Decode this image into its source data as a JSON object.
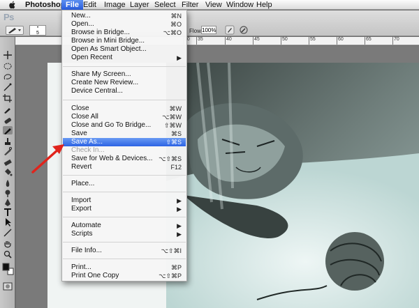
{
  "menubar": {
    "app": "Photoshop",
    "items": [
      "File",
      "Edit",
      "Image",
      "Layer",
      "Select",
      "Filter",
      "View",
      "Window",
      "Help"
    ]
  },
  "optionsbar": {
    "logo": "Ps",
    "brush_size": "5",
    "flow_label": "Flow:",
    "flow_value": "100%"
  },
  "ruler": {
    "labels": [
      "30",
      "35",
      "40",
      "45",
      "50",
      "55",
      "60",
      "65",
      "70"
    ]
  },
  "file_menu": {
    "groups": [
      [
        {
          "label": "New...",
          "shortcut": "⌘N"
        },
        {
          "label": "Open...",
          "shortcut": "⌘O"
        },
        {
          "label": "Browse in Bridge...",
          "shortcut": "⌥⌘O"
        },
        {
          "label": "Browse in Mini Bridge...",
          "shortcut": ""
        },
        {
          "label": "Open As Smart Object...",
          "shortcut": ""
        },
        {
          "label": "Open Recent",
          "shortcut": "▶"
        }
      ],
      [
        {
          "label": "Share My Screen...",
          "shortcut": ""
        },
        {
          "label": "Create New Review...",
          "shortcut": ""
        },
        {
          "label": "Device Central...",
          "shortcut": ""
        }
      ],
      [
        {
          "label": "Close",
          "shortcut": "⌘W"
        },
        {
          "label": "Close All",
          "shortcut": "⌥⌘W"
        },
        {
          "label": "Close and Go To Bridge...",
          "shortcut": "⇧⌘W"
        },
        {
          "label": "Save",
          "shortcut": "⌘S"
        },
        {
          "label": "Save As...",
          "shortcut": "⇧⌘S",
          "highlighted": true
        },
        {
          "label": "Check In...",
          "shortcut": "",
          "disabled": true
        },
        {
          "label": "Save for Web & Devices...",
          "shortcut": "⌥⇧⌘S"
        },
        {
          "label": "Revert",
          "shortcut": "F12"
        }
      ],
      [
        {
          "label": "Place...",
          "shortcut": ""
        }
      ],
      [
        {
          "label": "Import",
          "shortcut": "▶"
        },
        {
          "label": "Export",
          "shortcut": "▶"
        }
      ],
      [
        {
          "label": "Automate",
          "shortcut": "▶"
        },
        {
          "label": "Scripts",
          "shortcut": "▶"
        }
      ],
      [
        {
          "label": "File Info...",
          "shortcut": "⌥⇧⌘I"
        }
      ],
      [
        {
          "label": "Print...",
          "shortcut": "⌘P"
        },
        {
          "label": "Print One Copy",
          "shortcut": "⌥⇧⌘P"
        }
      ]
    ]
  },
  "colors": {
    "highlight": "#2c63e4",
    "annotation_arrow": "#e0241c"
  },
  "icons": [
    "apple-icon",
    "brush-tool-icon",
    "airbrush-icon",
    "move-tool-icon",
    "marquee-tool-icon",
    "lasso-tool-icon",
    "magic-wand-icon",
    "crop-tool-icon",
    "eyedropper-icon",
    "healing-brush-icon",
    "brush-icon",
    "stamp-icon",
    "history-brush-icon",
    "eraser-icon",
    "paint-bucket-icon",
    "blur-icon",
    "dodge-icon",
    "pen-tool-icon",
    "type-tool-icon",
    "path-select-icon",
    "shape-tool-icon",
    "hand-tool-icon",
    "zoom-tool-icon",
    "color-swatch-icon",
    "quick-mask-icon"
  ]
}
